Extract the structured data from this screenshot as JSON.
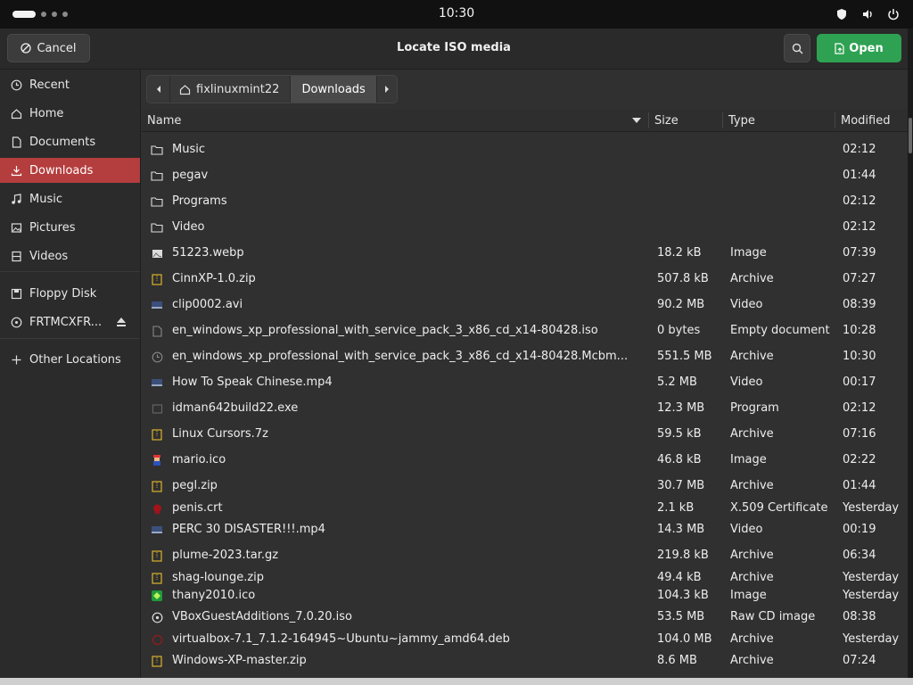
{
  "topbar": {
    "clock": "10:30"
  },
  "dialog": {
    "title": "Locate ISO media",
    "cancel_label": "Cancel",
    "open_label": "Open"
  },
  "sidebar": {
    "items": [
      {
        "label": "Recent",
        "icon": "clock-icon"
      },
      {
        "label": "Home",
        "icon": "home-icon"
      },
      {
        "label": "Documents",
        "icon": "document-icon"
      },
      {
        "label": "Downloads",
        "icon": "download-icon",
        "active": true
      },
      {
        "label": "Music",
        "icon": "music-icon"
      },
      {
        "label": "Pictures",
        "icon": "picture-icon"
      },
      {
        "label": "Videos",
        "icon": "film-icon"
      },
      {
        "label": "Floppy Disk",
        "icon": "floppy-icon"
      },
      {
        "label": "FRTMCXFR...",
        "icon": "disc-icon"
      },
      {
        "label": "Other Locations",
        "icon": "plus-icon"
      }
    ]
  },
  "pathbar": {
    "home": "fixlinuxmint22",
    "current": "Downloads"
  },
  "columns": {
    "name": "Name",
    "size": "Size",
    "type": "Type",
    "modified": "Modified"
  },
  "files": [
    {
      "name": "Music",
      "size": "",
      "type": "",
      "modified": "02:12",
      "icon": "folder-icon"
    },
    {
      "name": "pegav",
      "size": "",
      "type": "",
      "modified": "01:44",
      "icon": "folder-icon"
    },
    {
      "name": "Programs",
      "size": "",
      "type": "",
      "modified": "02:12",
      "icon": "folder-icon"
    },
    {
      "name": "Video",
      "size": "",
      "type": "",
      "modified": "02:12",
      "icon": "folder-icon"
    },
    {
      "name": "51223.webp",
      "size": "18.2 kB",
      "type": "Image",
      "modified": "07:39",
      "icon": "image-icon"
    },
    {
      "name": "CinnXP-1.0.zip",
      "size": "507.8 kB",
      "type": "Archive",
      "modified": "07:27",
      "icon": "archive-icon"
    },
    {
      "name": "clip0002.avi",
      "size": "90.2 MB",
      "type": "Video",
      "modified": "08:39",
      "icon": "video-icon"
    },
    {
      "name": "en_windows_xp_professional_with_service_pack_3_x86_cd_x14-80428.iso",
      "size": "0 bytes",
      "type": "Empty document",
      "modified": "10:28",
      "icon": "document-icon"
    },
    {
      "name": "en_windows_xp_professional_with_service_pack_3_x86_cd_x14-80428.Mcbm...",
      "size": "551.5 MB",
      "type": "Archive",
      "modified": "10:30",
      "icon": "clock-icon"
    },
    {
      "name": "How To Speak Chinese.mp4",
      "size": "5.2 MB",
      "type": "Video",
      "modified": "00:17",
      "icon": "video-icon"
    },
    {
      "name": "idman642build22.exe",
      "size": "12.3 MB",
      "type": "Program",
      "modified": "02:12",
      "icon": "program-icon"
    },
    {
      "name": "Linux Cursors.7z",
      "size": "59.5 kB",
      "type": "Archive",
      "modified": "07:16",
      "icon": "archive-icon"
    },
    {
      "name": "mario.ico",
      "size": "46.8 kB",
      "type": "Image",
      "modified": "02:22",
      "icon": "mario-icon"
    },
    {
      "name": "pegl.zip",
      "size": "30.7 MB",
      "type": "Archive",
      "modified": "01:44",
      "icon": "archive-icon"
    },
    {
      "name": "penis.crt",
      "size": "2.1 kB",
      "type": "X.509 Certificate",
      "modified": "Yesterday",
      "icon": "certificate-icon"
    },
    {
      "name": "PERC 30 DISASTER!!!.mp4",
      "size": "14.3 MB",
      "type": "Video",
      "modified": "00:19",
      "icon": "video-icon"
    },
    {
      "name": "plume-2023.tar.gz",
      "size": "219.8 kB",
      "type": "Archive",
      "modified": "06:34",
      "icon": "archive-icon"
    },
    {
      "name": "shag-lounge.zip",
      "size": "49.4 kB",
      "type": "Archive",
      "modified": "Yesterday",
      "icon": "archive-icon"
    },
    {
      "name": "thany2010.ico",
      "size": "104.3 kB",
      "type": "Image",
      "modified": "Yesterday",
      "icon": "green-icon"
    },
    {
      "name": "VBoxGuestAdditions_7.0.20.iso",
      "size": "53.5 MB",
      "type": "Raw CD image",
      "modified": "08:38",
      "icon": "disc-icon"
    },
    {
      "name": "virtualbox-7.1_7.1.2-164945~Ubuntu~jammy_amd64.deb",
      "size": "104.0 MB",
      "type": "Archive",
      "modified": "Yesterday",
      "icon": "package-icon"
    },
    {
      "name": "Windows-XP-master.zip",
      "size": "8.6 MB",
      "type": "Archive",
      "modified": "07:24",
      "icon": "archive-icon"
    }
  ]
}
